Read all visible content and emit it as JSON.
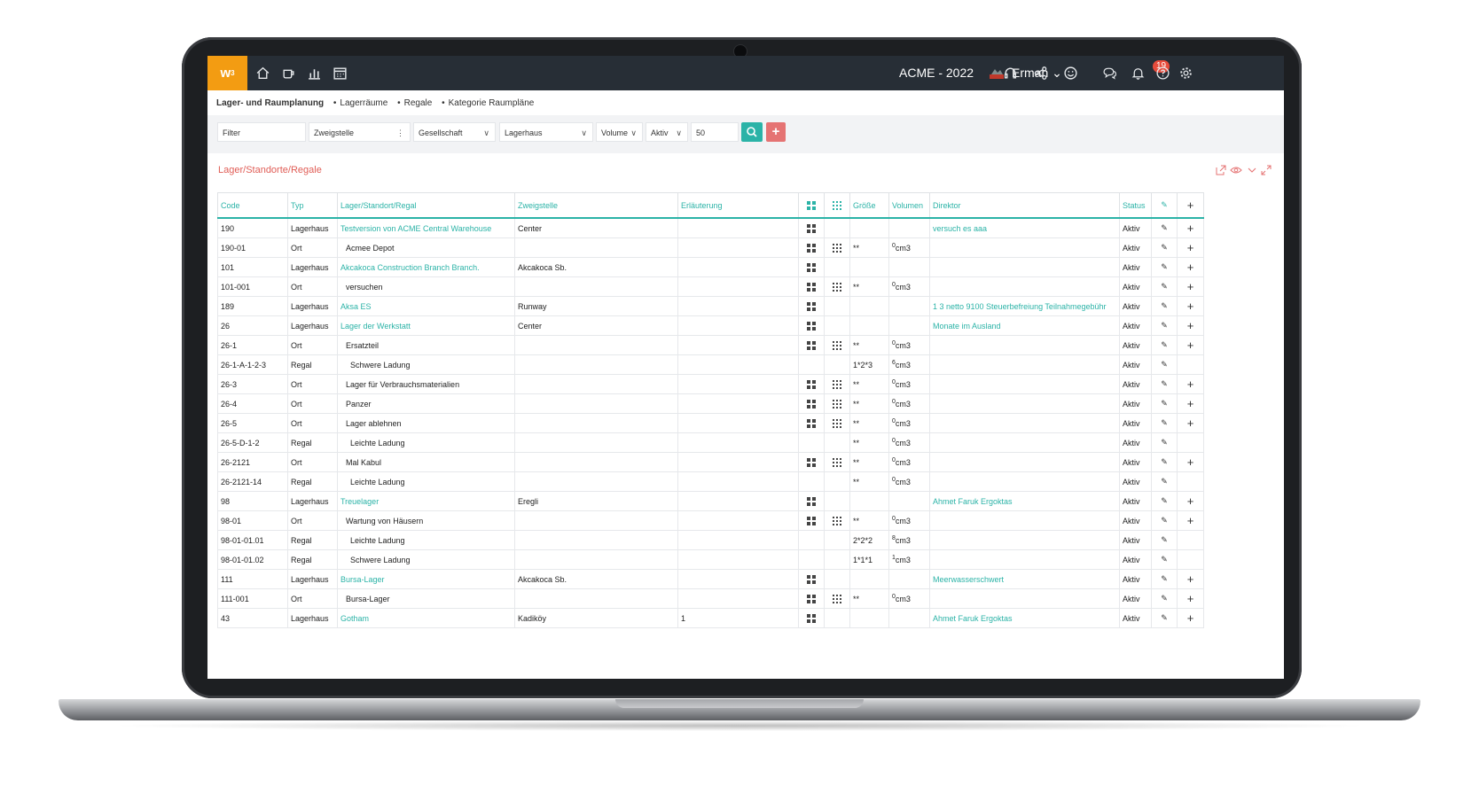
{
  "app": {
    "logo": "w",
    "logo_sup": "3",
    "company": "ACME - 2022",
    "user": "Erman",
    "notification_count": "19",
    "accent_color": "#2bb3a7",
    "brand_color": "#f39c12"
  },
  "breadcrumb": {
    "root": "Lager- und Raumplanung",
    "items": [
      "Lagerräume",
      "Regale",
      "Kategorie Raumpläne"
    ]
  },
  "filters": {
    "filter": "Filter",
    "zweigstelle": "Zweigstelle",
    "gesellschaft": "Gesellschaft",
    "lagerhaus": "Lagerhaus",
    "volume": "Volume",
    "aktiv": "Aktiv",
    "page_size": "50"
  },
  "panel": {
    "title": "Lager/Standorte/Regale"
  },
  "table": {
    "headers": {
      "code": "Code",
      "typ": "Typ",
      "lager": "Lager/Standort/Regal",
      "zweigstelle": "Zweigstelle",
      "erlaeuterung": "Erläuterung",
      "groesse": "Größe",
      "volumen": "Volumen",
      "direktor": "Direktor",
      "status": "Status"
    },
    "rows": [
      {
        "code": "190",
        "typ": "Lagerhaus",
        "name": "Testversion von ACME Central Warehouse",
        "zweig": "Center",
        "erl": "",
        "g1": true,
        "g2": false,
        "groesse": "",
        "vexp": "",
        "vunit": "",
        "direktor": "versuch es aaa",
        "status": "Aktiv",
        "add": true,
        "link": true,
        "indent": 0
      },
      {
        "code": "190-01",
        "typ": "Ort",
        "name": "Acmee Depot",
        "zweig": "",
        "erl": "",
        "g1": true,
        "g2": true,
        "groesse": "**",
        "vexp": "0",
        "vunit": "cm3",
        "direktor": "",
        "status": "Aktiv",
        "add": true,
        "link": false,
        "indent": 1
      },
      {
        "code": "101",
        "typ": "Lagerhaus",
        "name": "Akcakoca Construction Branch Branch.",
        "zweig": "Akcakoca Sb.",
        "erl": "",
        "g1": true,
        "g2": false,
        "groesse": "",
        "vexp": "",
        "vunit": "",
        "direktor": "",
        "status": "Aktiv",
        "add": true,
        "link": true,
        "indent": 0
      },
      {
        "code": "101-001",
        "typ": "Ort",
        "name": "versuchen",
        "zweig": "",
        "erl": "",
        "g1": true,
        "g2": true,
        "groesse": "**",
        "vexp": "0",
        "vunit": "cm3",
        "direktor": "",
        "status": "Aktiv",
        "add": true,
        "link": false,
        "indent": 1
      },
      {
        "code": "189",
        "typ": "Lagerhaus",
        "name": "Aksa ES",
        "zweig": "Runway",
        "erl": "",
        "g1": true,
        "g2": false,
        "groesse": "",
        "vexp": "",
        "vunit": "",
        "direktor": "1 3 netto 9100 Steuerbefreiung Teilnahmegebühr",
        "status": "Aktiv",
        "add": true,
        "link": true,
        "indent": 0
      },
      {
        "code": "26",
        "typ": "Lagerhaus",
        "name": "Lager der Werkstatt",
        "zweig": "Center",
        "erl": "",
        "g1": true,
        "g2": false,
        "groesse": "",
        "vexp": "",
        "vunit": "",
        "direktor": "Monate im Ausland",
        "status": "Aktiv",
        "add": true,
        "link": true,
        "indent": 0
      },
      {
        "code": "26-1",
        "typ": "Ort",
        "name": "Ersatzteil",
        "zweig": "",
        "erl": "",
        "g1": true,
        "g2": true,
        "groesse": "**",
        "vexp": "0",
        "vunit": "cm3",
        "direktor": "",
        "status": "Aktiv",
        "add": true,
        "link": false,
        "indent": 1
      },
      {
        "code": "26-1-A-1-2-3",
        "typ": "Regal",
        "name": "Schwere Ladung",
        "zweig": "",
        "erl": "",
        "g1": false,
        "g2": false,
        "groesse": "1*2*3",
        "vexp": "6",
        "vunit": "cm3",
        "direktor": "",
        "status": "Aktiv",
        "add": false,
        "link": false,
        "indent": 2
      },
      {
        "code": "26-3",
        "typ": "Ort",
        "name": "Lager für Verbrauchsmaterialien",
        "zweig": "",
        "erl": "",
        "g1": true,
        "g2": true,
        "groesse": "**",
        "vexp": "0",
        "vunit": "cm3",
        "direktor": "",
        "status": "Aktiv",
        "add": true,
        "link": false,
        "indent": 1
      },
      {
        "code": "26-4",
        "typ": "Ort",
        "name": "Panzer",
        "zweig": "",
        "erl": "",
        "g1": true,
        "g2": true,
        "groesse": "**",
        "vexp": "0",
        "vunit": "cm3",
        "direktor": "",
        "status": "Aktiv",
        "add": true,
        "link": false,
        "indent": 1
      },
      {
        "code": "26-5",
        "typ": "Ort",
        "name": "Lager ablehnen",
        "zweig": "",
        "erl": "",
        "g1": true,
        "g2": true,
        "groesse": "**",
        "vexp": "0",
        "vunit": "cm3",
        "direktor": "",
        "status": "Aktiv",
        "add": true,
        "link": false,
        "indent": 1
      },
      {
        "code": "26-5-D-1-2",
        "typ": "Regal",
        "name": "Leichte Ladung",
        "zweig": "",
        "erl": "",
        "g1": false,
        "g2": false,
        "groesse": "**",
        "vexp": "0",
        "vunit": "cm3",
        "direktor": "",
        "status": "Aktiv",
        "add": false,
        "link": false,
        "indent": 2
      },
      {
        "code": "26-2121",
        "typ": "Ort",
        "name": "Mal Kabul",
        "zweig": "",
        "erl": "",
        "g1": true,
        "g2": true,
        "groesse": "**",
        "vexp": "0",
        "vunit": "cm3",
        "direktor": "",
        "status": "Aktiv",
        "add": true,
        "link": false,
        "indent": 1
      },
      {
        "code": "26-2121-14",
        "typ": "Regal",
        "name": "Leichte Ladung",
        "zweig": "",
        "erl": "",
        "g1": false,
        "g2": false,
        "groesse": "**",
        "vexp": "0",
        "vunit": "cm3",
        "direktor": "",
        "status": "Aktiv",
        "add": false,
        "link": false,
        "indent": 2
      },
      {
        "code": "98",
        "typ": "Lagerhaus",
        "name": "Treuelager",
        "zweig": "Eregli",
        "erl": "",
        "g1": true,
        "g2": false,
        "groesse": "",
        "vexp": "",
        "vunit": "",
        "direktor": "Ahmet Faruk Ergoktas",
        "status": "Aktiv",
        "add": true,
        "link": true,
        "indent": 0
      },
      {
        "code": "98-01",
        "typ": "Ort",
        "name": "Wartung von Häusern",
        "zweig": "",
        "erl": "",
        "g1": true,
        "g2": true,
        "groesse": "**",
        "vexp": "0",
        "vunit": "cm3",
        "direktor": "",
        "status": "Aktiv",
        "add": true,
        "link": false,
        "indent": 1
      },
      {
        "code": "98-01-01.01",
        "typ": "Regal",
        "name": "Leichte Ladung",
        "zweig": "",
        "erl": "",
        "g1": false,
        "g2": false,
        "groesse": "2*2*2",
        "vexp": "8",
        "vunit": "cm3",
        "direktor": "",
        "status": "Aktiv",
        "add": false,
        "link": false,
        "indent": 2
      },
      {
        "code": "98-01-01.02",
        "typ": "Regal",
        "name": "Schwere Ladung",
        "zweig": "",
        "erl": "",
        "g1": false,
        "g2": false,
        "groesse": "1*1*1",
        "vexp": "1",
        "vunit": "cm3",
        "direktor": "",
        "status": "Aktiv",
        "add": false,
        "link": false,
        "indent": 2
      },
      {
        "code": "111",
        "typ": "Lagerhaus",
        "name": "Bursa-Lager",
        "zweig": "Akcakoca Sb.",
        "erl": "",
        "g1": true,
        "g2": false,
        "groesse": "",
        "vexp": "",
        "vunit": "",
        "direktor": "Meerwasserschwert",
        "status": "Aktiv",
        "add": true,
        "link": true,
        "indent": 0
      },
      {
        "code": "111-001",
        "typ": "Ort",
        "name": "Bursa-Lager",
        "zweig": "",
        "erl": "",
        "g1": true,
        "g2": true,
        "groesse": "**",
        "vexp": "0",
        "vunit": "cm3",
        "direktor": "",
        "status": "Aktiv",
        "add": true,
        "link": false,
        "indent": 1
      },
      {
        "code": "43",
        "typ": "Lagerhaus",
        "name": "Gotham",
        "zweig": "Kadiköy",
        "erl": "1",
        "g1": true,
        "g2": false,
        "groesse": "",
        "vexp": "",
        "vunit": "",
        "direktor": "Ahmet Faruk Ergoktas",
        "status": "Aktiv",
        "add": true,
        "link": true,
        "indent": 0
      }
    ]
  }
}
